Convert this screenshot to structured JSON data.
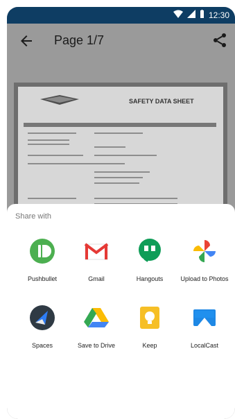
{
  "status": {
    "time": "12:30"
  },
  "appbar": {
    "title": "Page 1/7"
  },
  "document": {
    "header_title": "SAFETY DATA SHEET"
  },
  "share_sheet": {
    "label": "Share with",
    "apps": [
      {
        "label": "Pushbullet",
        "icon": "pushbullet-icon"
      },
      {
        "label": "Gmail",
        "icon": "gmail-icon"
      },
      {
        "label": "Hangouts",
        "icon": "hangouts-icon"
      },
      {
        "label": "Upload to Photos",
        "icon": "photos-icon"
      },
      {
        "label": "Spaces",
        "icon": "spaces-icon"
      },
      {
        "label": "Save to Drive",
        "icon": "drive-icon"
      },
      {
        "label": "Keep",
        "icon": "keep-icon"
      },
      {
        "label": "LocalCast",
        "icon": "localcast-icon"
      }
    ]
  },
  "colors": {
    "status_bar": "#0e3d63",
    "dim_overlay": "#9a9a9a",
    "pushbullet": "#4caf50",
    "gmail_red": "#e53935",
    "hangouts": "#0f9d58",
    "spaces_dark": "#2f3a44",
    "keep": "#f6bf26",
    "localcast": "#1e88e5"
  }
}
